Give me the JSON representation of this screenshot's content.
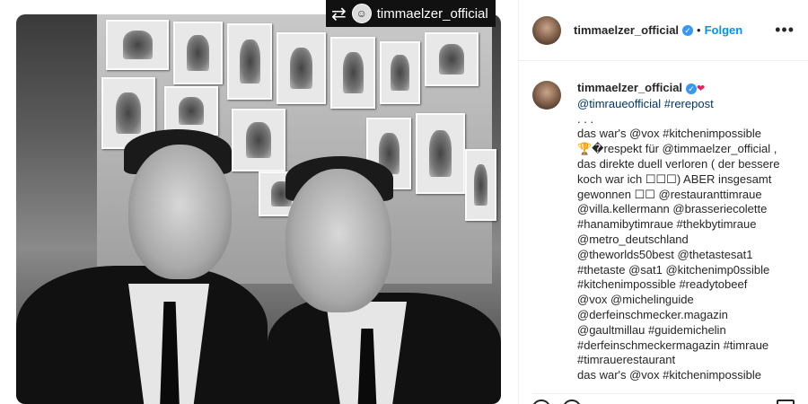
{
  "repost_badge": {
    "icon": "repost-icon",
    "username": "timmaelzer_official"
  },
  "header": {
    "username": "timmaelzer_official",
    "separator": "•",
    "follow_label": "Folgen",
    "more_icon": "more-options-icon"
  },
  "caption": {
    "username": "timmaelzer_official",
    "lines": [
      "@timraueofficial #rerepost",
      ". . .",
      "das war's @vox #kitchenimpossible",
      "🏆�respekt für @timmaelzer_official ,",
      "das direkte duell verloren ( der bessere",
      "koch war ich ☐☐☐) ABER insgesamt",
      "gewonnen ☐☐ @restauranttimraue",
      "@villa.kellermann @brasseriecolette",
      "#hanamibytimraue #thekbytimraue",
      "@metro_deutschland",
      "@theworlds50best @thetastesat1",
      "#thetaste @sat1 @kitchenimp0ssible",
      "#kitchenimpossible #readytobeef",
      "@vox @michelinguide",
      "@derfeinschmecker.magazin",
      "@gaultmillau #guidemichelin",
      "#derfeinschmeckermagazin #timraue",
      "#timrauerestaurant",
      "das war's @vox #kitchenimpossible"
    ]
  },
  "colors": {
    "link": "#00376b",
    "follow": "#0095f6",
    "verified": "#3897f0"
  }
}
